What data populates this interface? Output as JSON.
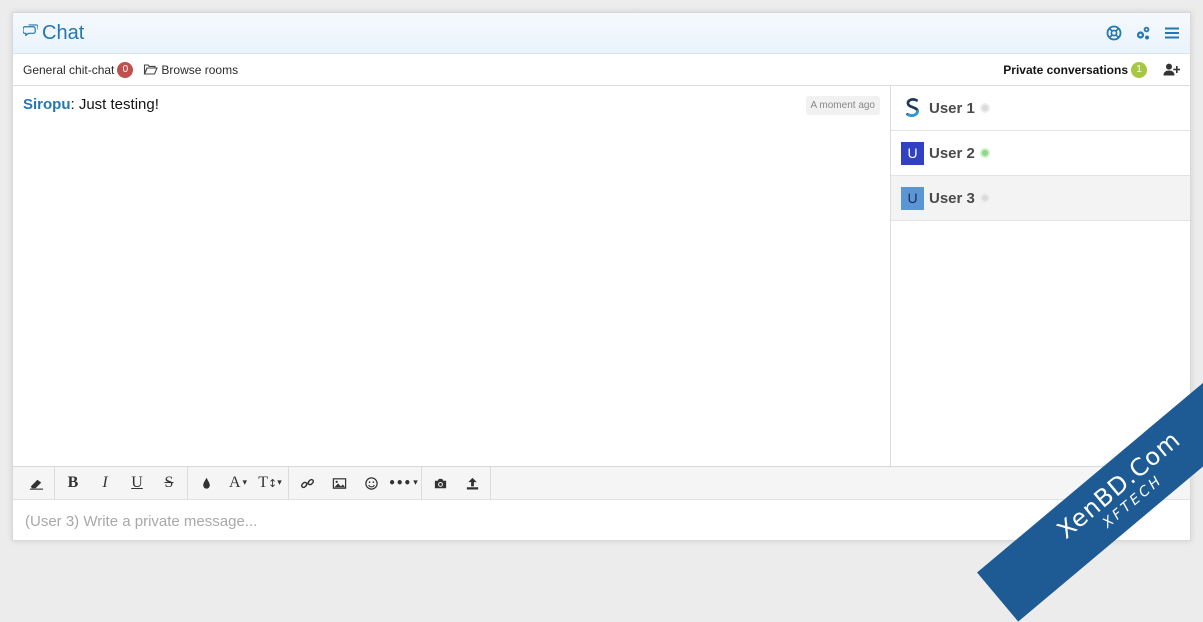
{
  "header": {
    "title": "Chat",
    "icons": [
      "chat-bubble-icon",
      "help-icon",
      "settings-icon",
      "menu-icon"
    ]
  },
  "tabs": {
    "general": {
      "label": "General chit-chat",
      "count": "0"
    },
    "browse": {
      "label": "Browse rooms"
    },
    "private": {
      "label": "Private conversations",
      "count": "1"
    }
  },
  "messages": [
    {
      "author": "Siropu",
      "text": ": Just testing!",
      "time": "A moment ago"
    }
  ],
  "users": [
    {
      "name": "User 1",
      "avatar": "",
      "status": "offline"
    },
    {
      "name": "User 2",
      "avatar": "U",
      "status": "online"
    },
    {
      "name": "User 3",
      "avatar": "U",
      "status": "offline"
    }
  ],
  "toolbar": {
    "bold": "B",
    "italic": "I",
    "underline": "U",
    "strike": "S",
    "font": "A",
    "size": "T"
  },
  "editor": {
    "placeholder": "(User 3) Write a private message..."
  },
  "watermark": {
    "line1": "XenBD.Com",
    "line2": "XFTECH"
  },
  "colors": {
    "accent": "#2577b1",
    "badge_red": "#c0504d",
    "badge_green": "#a6c644",
    "online": "#8fd88a"
  }
}
